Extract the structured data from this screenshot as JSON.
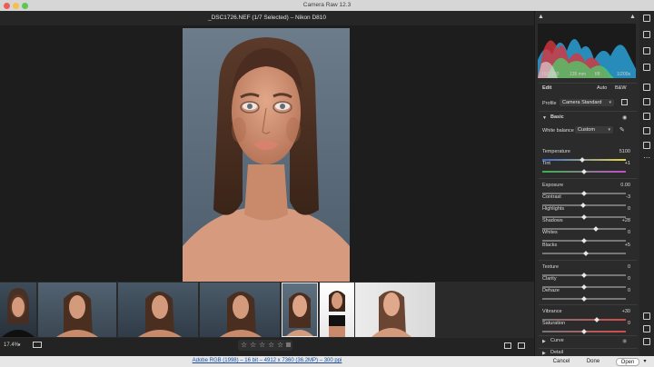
{
  "window": {
    "title": "Camera Raw 12.3"
  },
  "header": {
    "file_title": "_DSC1726.NEF (1/7 Selected)  –  Nikon D810"
  },
  "exif": {
    "iso": "ISO 100",
    "focal": "135 mm",
    "aperture": "f/8",
    "shutter": "1/200s"
  },
  "edit": {
    "title": "Edit",
    "auto_label": "Auto",
    "bw_label": "B&W",
    "profile_label": "Profile",
    "profile_value": "Camera Standard"
  },
  "basic": {
    "title": "Basic",
    "wb_label": "White balance",
    "wb_value": "Custom",
    "sliders": [
      {
        "label": "Temperature",
        "value": "5100",
        "pos": 0.48
      },
      {
        "label": "Tint",
        "value": "+1",
        "pos": 0.5
      },
      {
        "label": "Exposure",
        "value": "0.00",
        "pos": 0.5
      },
      {
        "label": "Contrast",
        "value": "-3",
        "pos": 0.49
      },
      {
        "label": "Highlights",
        "value": "0",
        "pos": 0.5
      },
      {
        "label": "Shadows",
        "value": "+28",
        "pos": 0.64
      },
      {
        "label": "Whites",
        "value": "0",
        "pos": 0.5
      },
      {
        "label": "Blacks",
        "value": "+5",
        "pos": 0.52
      },
      {
        "label": "Texture",
        "value": "0",
        "pos": 0.5
      },
      {
        "label": "Clarity",
        "value": "0",
        "pos": 0.5
      },
      {
        "label": "Dehaze",
        "value": "0",
        "pos": 0.5
      },
      {
        "label": "Vibrance",
        "value": "+30",
        "pos": 0.65
      },
      {
        "label": "Saturation",
        "value": "0",
        "pos": 0.5
      }
    ]
  },
  "sections": {
    "curve": "Curve",
    "detail": "Detail"
  },
  "bottom": {
    "zoom": "17.4%"
  },
  "footer": {
    "info": "Adobe RGB (1998) – 16 bit – 4912 x 7360 (36.2MP) – 300 ppi",
    "cancel": "Cancel",
    "done": "Done",
    "open": "Open"
  },
  "colors": {
    "accent": "#1a4d9c",
    "panel": "#2b2b2b"
  }
}
